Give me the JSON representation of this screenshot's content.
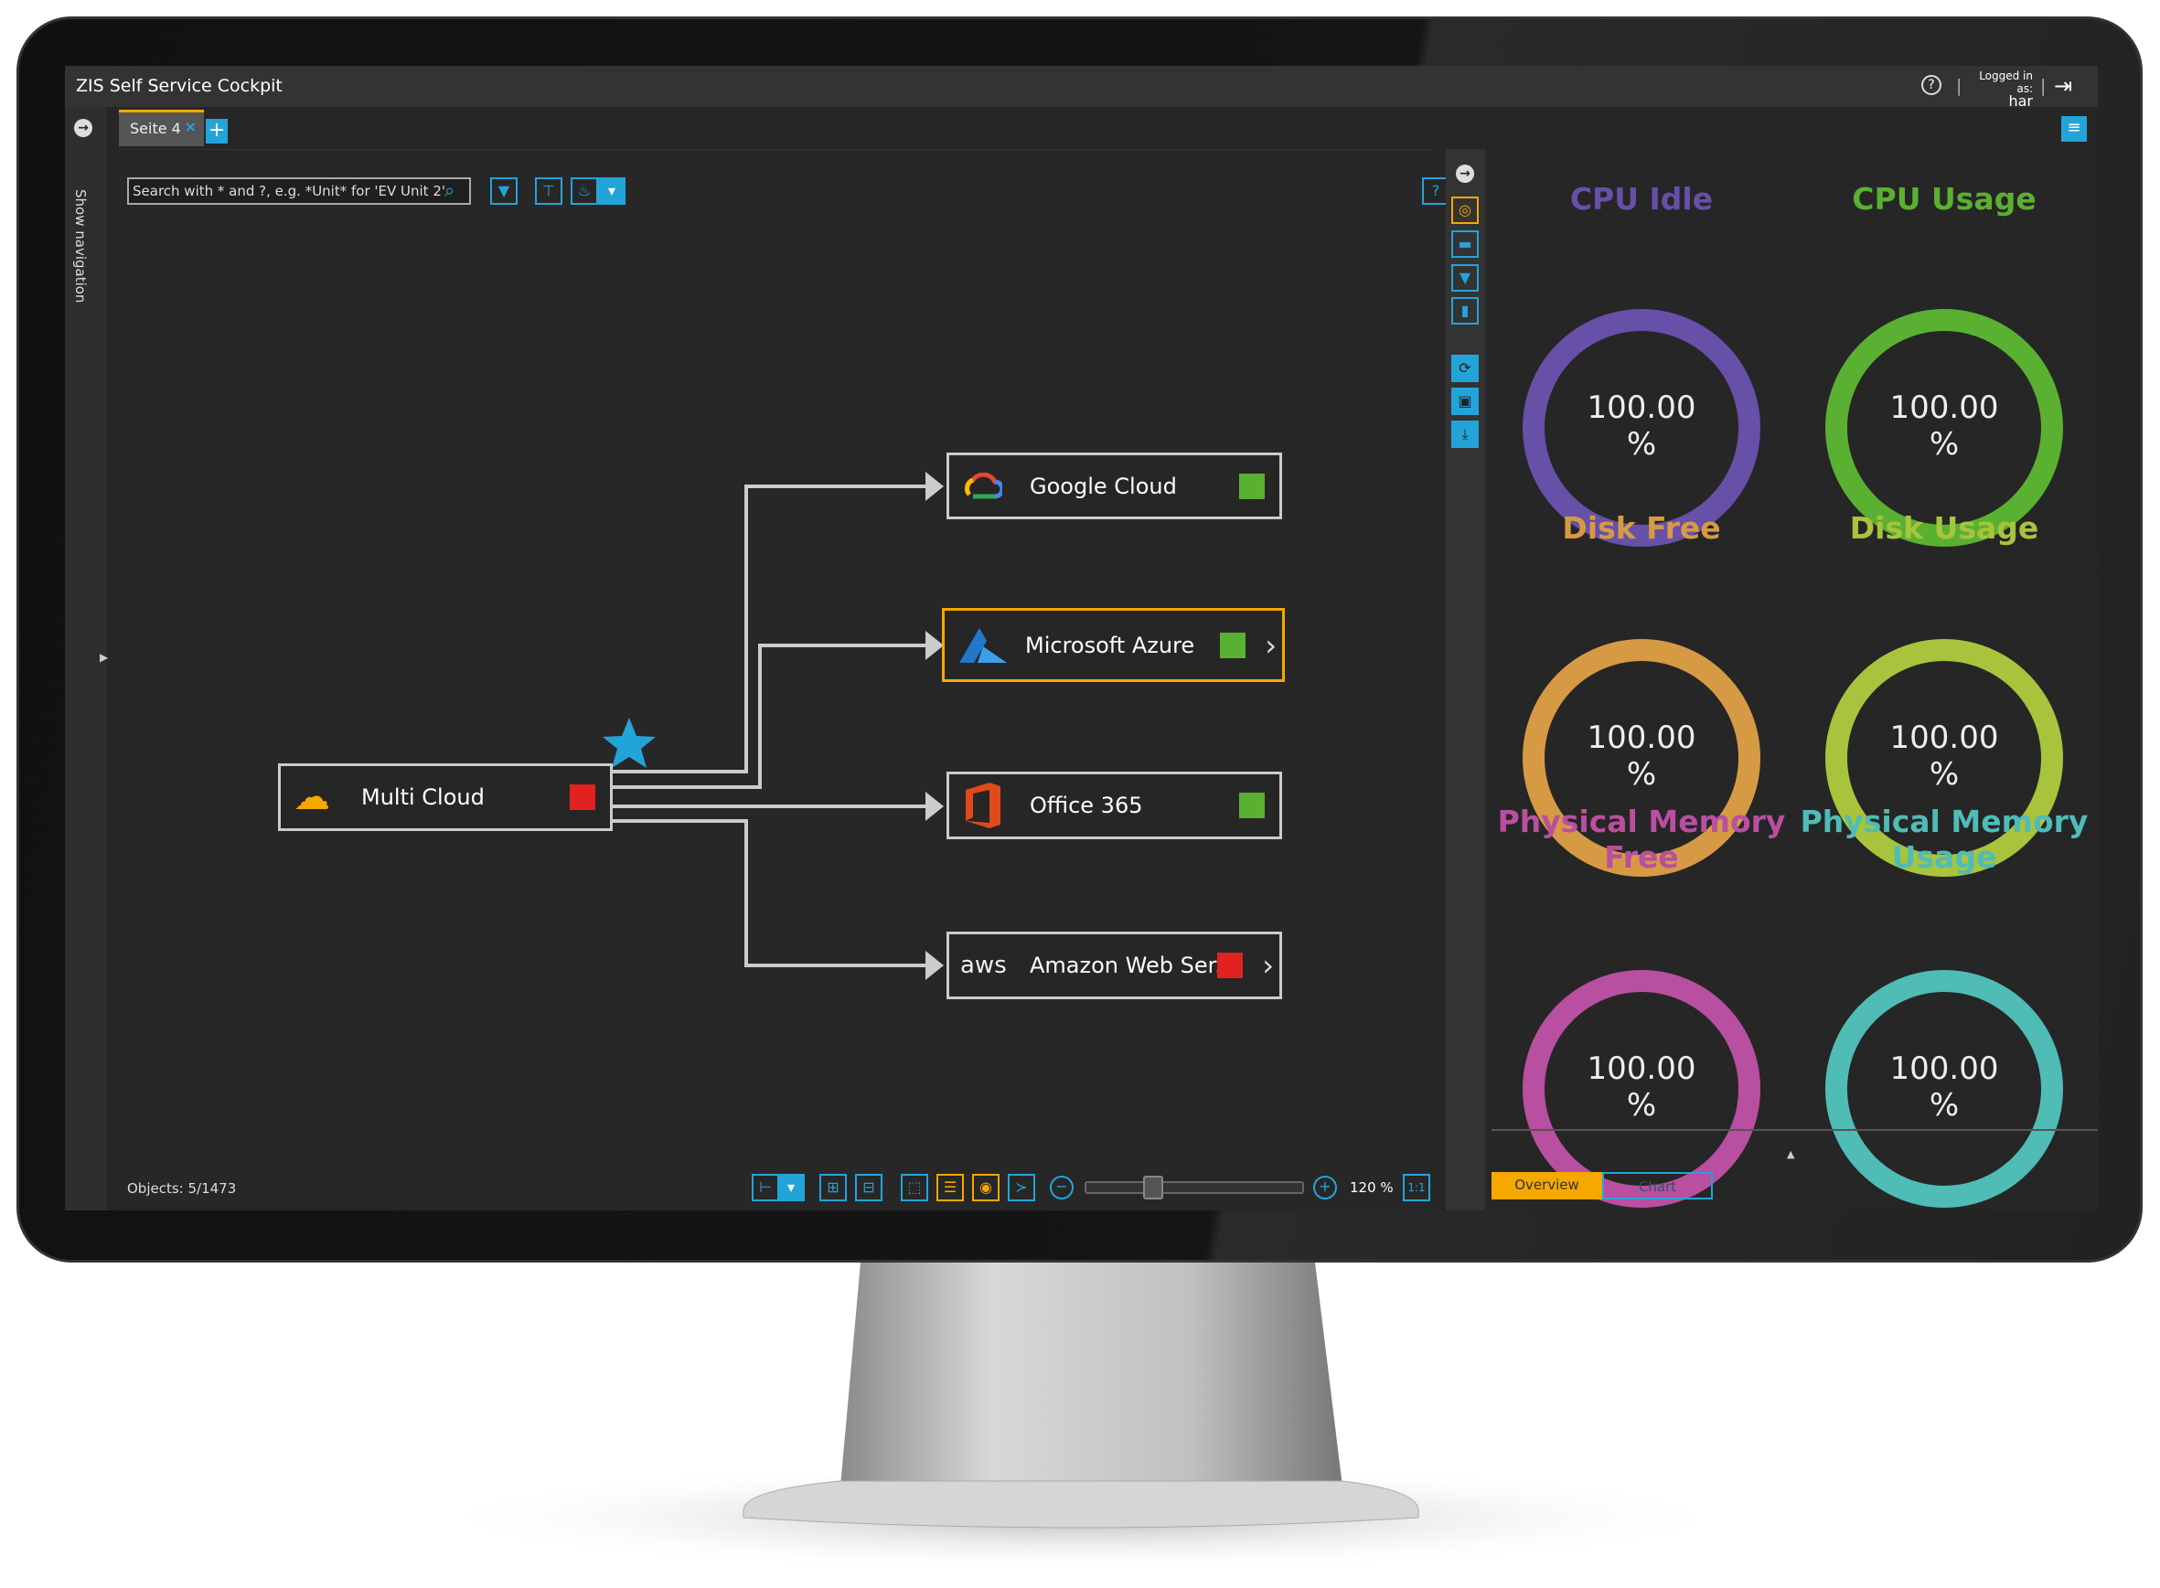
{
  "app": {
    "title": "ZIS Self Service Cockpit",
    "logged_in_label": "Logged in as:",
    "user": "har"
  },
  "nav": {
    "show_navigation": "Show navigation"
  },
  "tabs": [
    {
      "label": "Seite 4",
      "close": "×"
    }
  ],
  "add_tab": "+",
  "search": {
    "placeholder": "Search with * and ?, e.g. *Unit* for 'EV Unit 2'"
  },
  "nodes": [
    {
      "label": "Multi Cloud",
      "status": "red",
      "icon": "cloud-icon"
    },
    {
      "label": "Google Cloud",
      "status": "green",
      "icon": "google-cloud-icon"
    },
    {
      "label": "Microsoft Azure",
      "status": "green",
      "icon": "azure-icon",
      "selected": true,
      "expandable": true
    },
    {
      "label": "Office 365",
      "status": "green",
      "icon": "office-icon"
    },
    {
      "label": "Amazon Web Ser...",
      "status": "red",
      "icon": "aws-icon",
      "expandable": true
    }
  ],
  "aws_logo_text": "aws",
  "status_colors": {
    "red": "#e32121",
    "green": "#5ab031"
  },
  "gauges": [
    {
      "title": "CPU Idle",
      "value": "100.00",
      "unit": "%",
      "percent": 100,
      "color": "#6650a8"
    },
    {
      "title": "CPU Usage",
      "value": "100.00",
      "unit": "%",
      "percent": 100,
      "color": "#5ab031"
    },
    {
      "title": "Disk Free",
      "value": "100.00",
      "unit": "%",
      "percent": 100,
      "color": "#d69a45"
    },
    {
      "title": "Disk Usage",
      "value": "100.00",
      "unit": "%",
      "percent": 100,
      "color": "#a8c43c"
    },
    {
      "title": "Physical Memory Free",
      "value": "100.00",
      "unit": "%",
      "percent": 100,
      "color": "#b94fa0"
    },
    {
      "title": "Physical Memory Usage",
      "value": "100.00",
      "unit": "%",
      "percent": 100,
      "color": "#4fbcb6"
    }
  ],
  "panel_tabs": [
    {
      "label": "Overview",
      "active": true
    },
    {
      "label": "Chart",
      "active": false
    }
  ],
  "statusbar": {
    "objects": "Objects: 5/1473",
    "zoom": "120 %",
    "zoom_percent": 120,
    "one_to_one": "1:1"
  },
  "colors": {
    "accent": "#23a4d9",
    "highlight": "#f5a800"
  }
}
